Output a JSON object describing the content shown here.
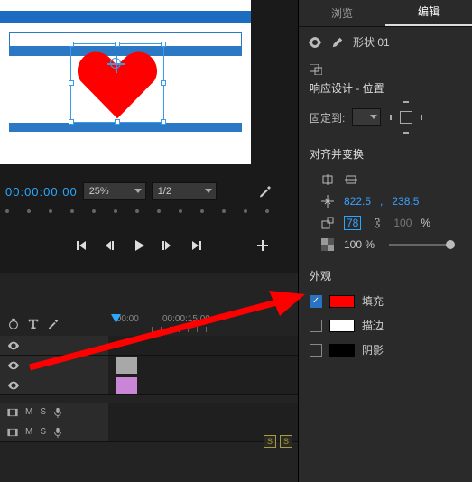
{
  "tabs": {
    "browse": "浏览",
    "edit": "编辑"
  },
  "shape": {
    "label": "形状 01"
  },
  "responsive": {
    "title": "响应设计 - 位置",
    "pin_label": "固定到:"
  },
  "align": {
    "title": "对齐并变换",
    "pos_x": "822.5",
    "pos_comma": ",",
    "pos_y": "238.5",
    "scale_w": "78",
    "scale_h": "100",
    "pct": "%",
    "opacity": "100 %"
  },
  "appearance": {
    "title": "外观",
    "fill": "填充",
    "stroke": "描边",
    "shadow": "阴影",
    "fill_color": "#ff0000",
    "stroke_color": "#ffffff",
    "shadow_color": "#000000"
  },
  "timecode": "00:00:00:00",
  "zoom": {
    "scale": "25%",
    "res": "1/2"
  },
  "ruler": {
    "t0": ":00:00",
    "t1": "00:00:15:00"
  },
  "track_btn": {
    "m": "M",
    "s": "S"
  },
  "marker": "S"
}
